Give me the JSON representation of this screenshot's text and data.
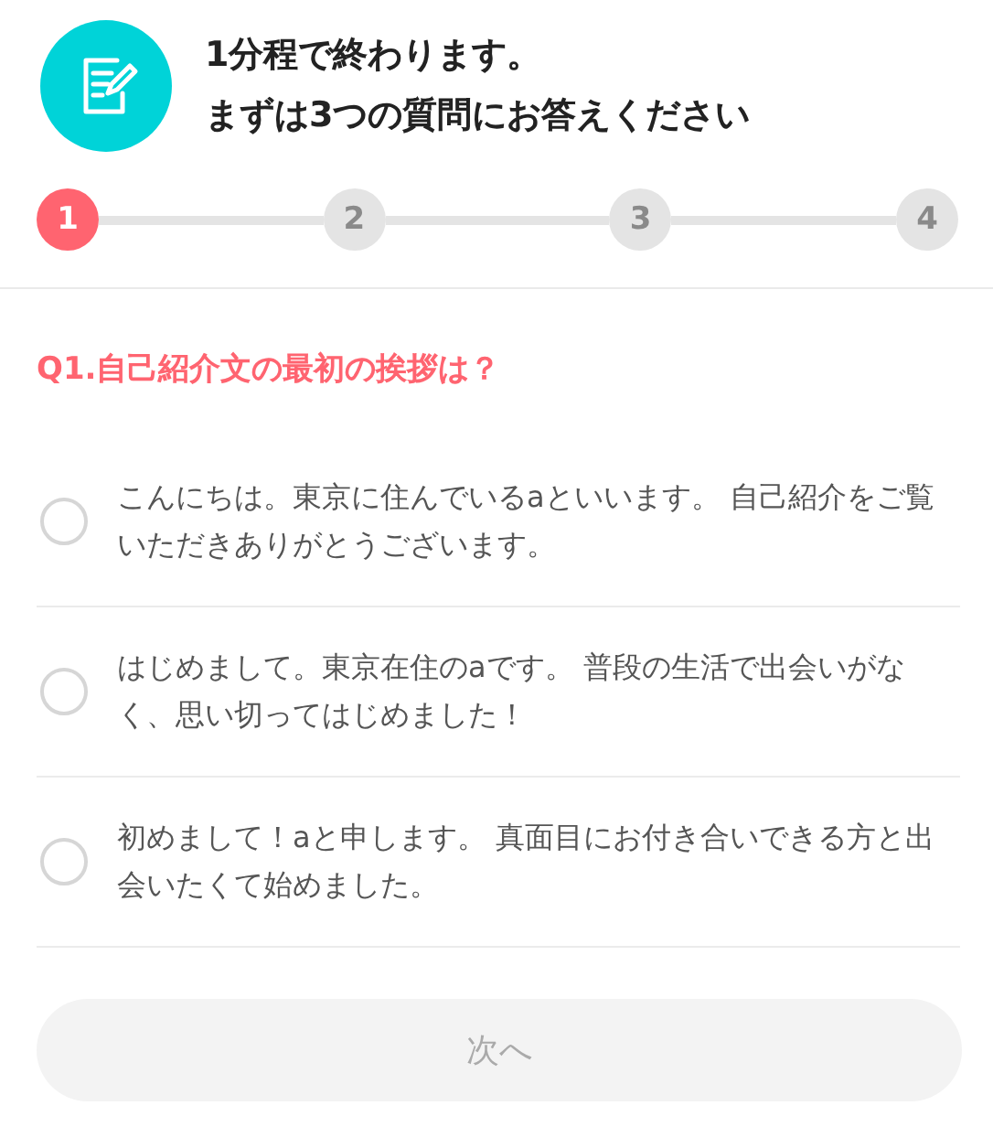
{
  "header": {
    "lines": [
      "1分程で終わります。",
      "まずは3つの質問にお答えください"
    ]
  },
  "steps": [
    {
      "label": "1",
      "selected": true
    },
    {
      "label": "2",
      "selected": false
    },
    {
      "label": "3",
      "selected": false
    },
    {
      "label": "4",
      "selected": false
    }
  ],
  "question": "Q1.自己紹介文の最初の挨拶は？",
  "options": [
    {
      "text": "こんにちは。東京に住んでいるaといいます。 自己紹介をご覧いただきありがとうございます。",
      "selected": false
    },
    {
      "text": "はじめまして。東京在住のaです。 普段の生活で出会いがなく、思い切ってはじめました！",
      "selected": false
    },
    {
      "text": "初めまして！aと申します。 真面目にお付き合いできる方と出会いたくて始めました。",
      "selected": false
    }
  ],
  "next_button": {
    "label": "次へ",
    "disabled": true
  }
}
